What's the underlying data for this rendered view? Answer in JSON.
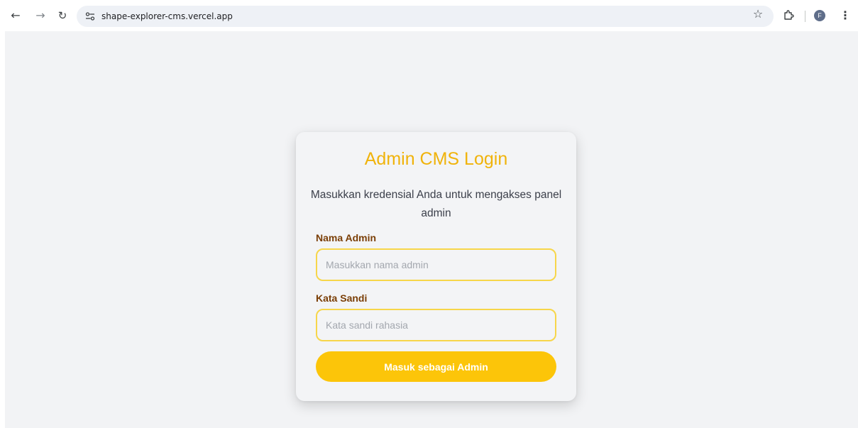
{
  "browser": {
    "url": "shape-explorer-cms.vercel.app",
    "back_icon": "arrow-left-icon",
    "forward_icon": "arrow-right-icon",
    "reload_icon": "reload-icon",
    "profile_initial": "F"
  },
  "login": {
    "title": "Admin CMS Login",
    "subtitle": "Masukkan kredensial Anda untuk mengakses panel admin",
    "name_label": "Nama Admin",
    "name_placeholder": "Masukkan nama admin",
    "name_value": "",
    "password_label": "Kata Sandi",
    "password_placeholder": "Kata sandi rahasia",
    "password_value": "",
    "submit_label": "Masuk sebagai Admin"
  },
  "colors": {
    "accent": "#fcc509",
    "title": "#f0b30a",
    "label": "#7a3e06",
    "input_border": "#f7d64a",
    "page_bg": "#f2f3f5"
  }
}
